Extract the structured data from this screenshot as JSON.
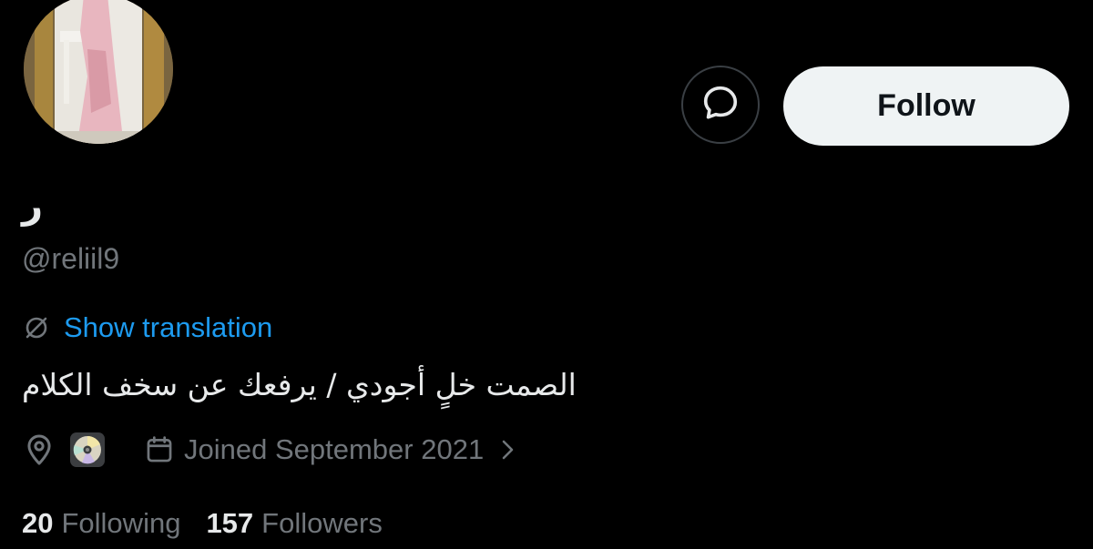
{
  "profile": {
    "display_name": "ر",
    "handle": "@reliil9",
    "bio": "الصمت خلٍ أجودي / يرفعك عن سخف الكلام"
  },
  "actions": {
    "message_icon": "message-bubble-icon",
    "follow_label": "Follow"
  },
  "translation": {
    "icon": "translate-icon",
    "label": "Show translation"
  },
  "meta": {
    "location_icon": "location-pin-icon",
    "location_emoji_icon": "dvd-disc-icon",
    "calendar_icon": "calendar-icon",
    "joined": "Joined September 2021",
    "chevron_icon": "chevron-right-icon"
  },
  "stats": {
    "following_count": "20",
    "following_label": "Following",
    "followers_count": "157",
    "followers_label": "Followers"
  },
  "colors": {
    "background": "#000000",
    "text_primary": "#e7e9ea",
    "text_secondary": "#71767b",
    "link": "#1d9bf0",
    "follow_bg": "#eff3f4",
    "border": "#3a3f44"
  }
}
